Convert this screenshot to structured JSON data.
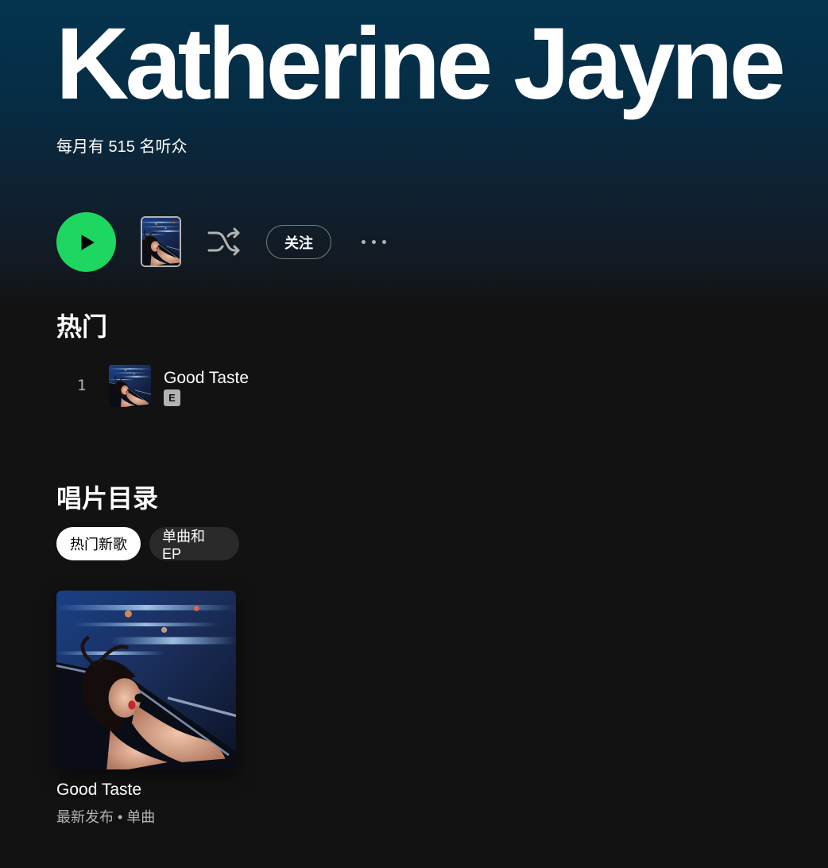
{
  "artist": {
    "name": "Katherine Jayne",
    "monthly_listeners": "每月有 515 名听众"
  },
  "actions": {
    "follow_label": "关注",
    "play_icon": "play-icon",
    "shuffle_icon": "shuffle-icon",
    "more_icon": "more-options-icon"
  },
  "popular": {
    "title": "热门",
    "tracks": [
      {
        "number": "1",
        "title": "Good Taste",
        "explicit": "E"
      }
    ]
  },
  "discography": {
    "title": "唱片目录",
    "filters": [
      "热门新歌",
      "单曲和 EP"
    ],
    "albums": [
      {
        "title": "Good Taste",
        "meta": "最新发布 • 单曲"
      }
    ]
  },
  "colors": {
    "accent": "#1ed760",
    "background": "#121212",
    "header_gradient_top": "#04344f",
    "secondary_text": "#b3b3b3"
  }
}
